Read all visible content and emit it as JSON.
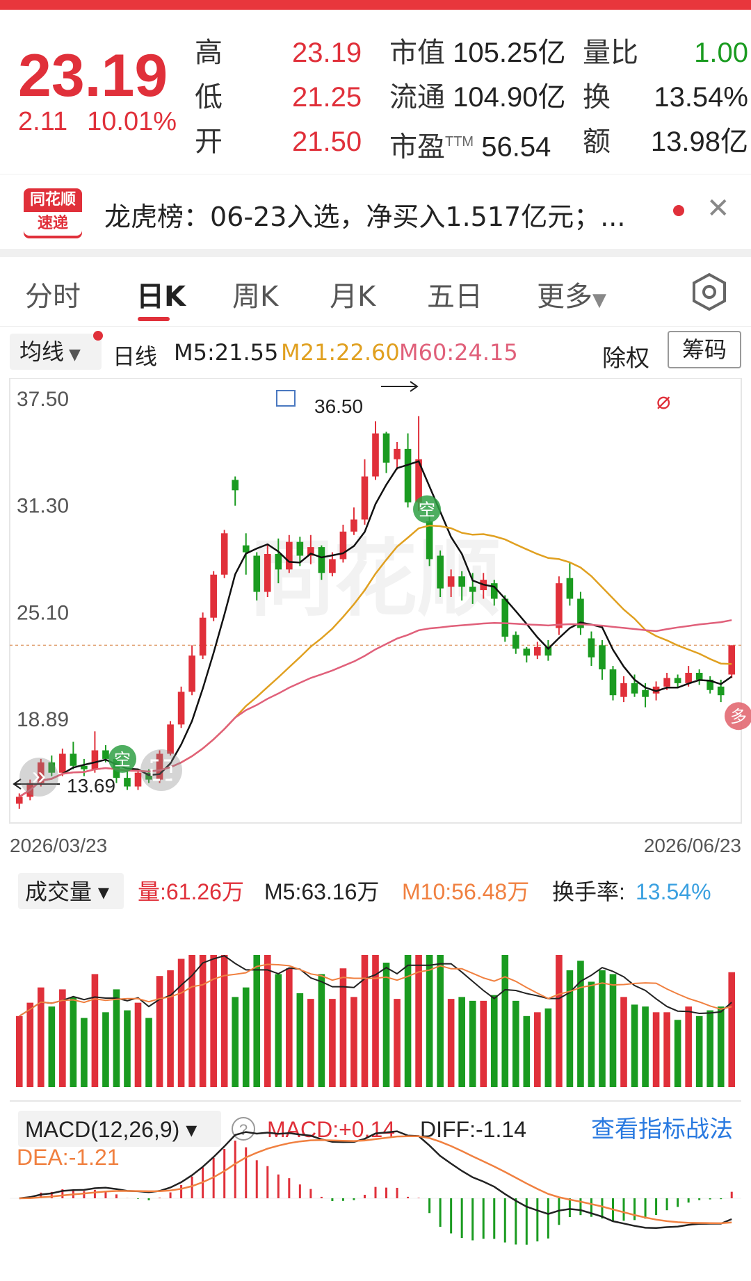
{
  "quote": {
    "price": "23.19",
    "change": "2.11",
    "change_pct": "10.01%",
    "high_label": "高",
    "high": "23.19",
    "low_label": "低",
    "low": "21.25",
    "open_label": "开",
    "open": "21.50",
    "mktcap_label": "市值",
    "mktcap": "105.25亿",
    "float_label": "流通",
    "float": "104.90亿",
    "pe_label": "市盈",
    "pe_sup": "TTM",
    "pe": "56.54",
    "volratio_label": "量比",
    "volratio": "1.00",
    "turnover_label": "换",
    "turnover": "13.54%",
    "amount_label": "额",
    "amount": "13.98亿"
  },
  "news": {
    "logo_top": "同花顺",
    "logo_bottom": "速递",
    "text": "龙虎榜：06-23入选，净买入1.517亿元；..."
  },
  "tabs": [
    "分时",
    "日K",
    "周K",
    "月K",
    "五日",
    "更多"
  ],
  "active_tab": "日K",
  "indicator_bar": {
    "ma_select": "均线",
    "period": "日线",
    "m5": "M5:21.55",
    "m21": "M21:22.60",
    "m60": "M60:24.15",
    "adjust": "除权",
    "chips": "筹码"
  },
  "colors": {
    "up": "#e0303a",
    "down": "#1a9b20",
    "m5": "#111111",
    "m21": "#e0a020",
    "m60": "#e0607a",
    "vol_m10": "#f08040",
    "turnover": "#3aa0e0",
    "link": "#2a7ae0"
  },
  "kline": {
    "y_ticks": [
      "37.50",
      "31.30",
      "25.10",
      "18.89"
    ],
    "x_start": "2026/03/23",
    "x_end": "2026/06/23",
    "max_label": "36.50",
    "min_label": "13.69",
    "badge_empty": "空",
    "badge_many": "多",
    "watermark": "同花顺"
  },
  "volume": {
    "select": "成交量",
    "vol": "量:61.26万",
    "m5": "M5:63.16万",
    "m10": "M10:56.48万",
    "turnover_label": "换手率:",
    "turnover": "13.54%"
  },
  "macd": {
    "select": "MACD(12,26,9)",
    "macd": "MACD:+0.14",
    "diff": "DIFF:-1.14",
    "dea": "DEA:-1.21",
    "link": "查看指标战法"
  },
  "chart_data": {
    "type": "candlestick",
    "title": "",
    "x_range": [
      "2026/03/23",
      "2026/06/23"
    ],
    "ylim": [
      13.69,
      37.5
    ],
    "candles": [
      [
        14.0,
        14.4,
        13.7,
        14.6
      ],
      [
        14.4,
        15.2,
        14.2,
        15.4
      ],
      [
        15.2,
        16.4,
        15.0,
        16.6
      ],
      [
        16.4,
        15.8,
        15.6,
        16.8
      ],
      [
        15.8,
        16.9,
        15.6,
        17.2
      ],
      [
        16.9,
        16.2,
        16.0,
        17.6
      ],
      [
        16.2,
        16.0,
        15.6,
        16.6
      ],
      [
        16.0,
        17.1,
        15.8,
        18.2
      ],
      [
        17.1,
        16.6,
        16.4,
        17.4
      ],
      [
        16.6,
        15.5,
        15.2,
        16.8
      ],
      [
        15.5,
        15.0,
        14.8,
        15.9
      ],
      [
        15.0,
        15.8,
        14.8,
        16.0
      ],
      [
        15.8,
        15.4,
        15.2,
        16.0
      ],
      [
        15.4,
        16.9,
        15.2,
        17.1
      ],
      [
        16.9,
        18.6,
        16.8,
        18.8
      ],
      [
        18.6,
        20.5,
        18.4,
        20.8
      ],
      [
        20.5,
        22.6,
        20.3,
        23.2
      ],
      [
        22.6,
        24.8,
        22.4,
        25.1
      ],
      [
        24.8,
        27.3,
        24.6,
        27.5
      ],
      [
        27.3,
        29.7,
        27.1,
        29.9
      ],
      [
        32.8,
        32.2,
        31.3,
        33.0
      ],
      [
        29.0,
        28.6,
        27.3,
        29.7
      ],
      [
        28.4,
        26.3,
        25.8,
        28.6
      ],
      [
        26.3,
        28.5,
        26.0,
        29.1
      ],
      [
        28.5,
        27.6,
        26.8,
        29.4
      ],
      [
        27.6,
        29.2,
        27.4,
        29.6
      ],
      [
        29.2,
        28.4,
        27.8,
        29.5
      ],
      [
        28.4,
        28.9,
        27.9,
        29.6
      ],
      [
        28.9,
        27.4,
        27.0,
        29.0
      ],
      [
        27.4,
        28.2,
        27.2,
        28.6
      ],
      [
        28.2,
        29.8,
        28.0,
        30.2
      ],
      [
        29.8,
        30.5,
        29.6,
        31.2
      ],
      [
        30.5,
        33.0,
        30.2,
        34.0
      ],
      [
        33.0,
        35.5,
        32.8,
        36.2
      ],
      [
        35.5,
        33.8,
        33.2,
        35.6
      ],
      [
        34.0,
        34.6,
        33.4,
        35.0
      ],
      [
        34.6,
        31.5,
        31.2,
        35.5
      ],
      [
        31.5,
        34.0,
        31.0,
        36.5
      ],
      [
        30.4,
        28.2,
        27.8,
        30.8
      ],
      [
        28.4,
        26.5,
        26.0,
        28.7
      ],
      [
        26.6,
        27.2,
        26.0,
        27.6
      ],
      [
        27.2,
        26.6,
        25.8,
        27.5
      ],
      [
        26.6,
        26.3,
        25.6,
        27.4
      ],
      [
        26.4,
        27.0,
        25.9,
        27.4
      ],
      [
        26.8,
        25.9,
        25.5,
        27.0
      ],
      [
        25.9,
        23.7,
        23.4,
        26.1
      ],
      [
        23.8,
        23.0,
        22.7,
        24.0
      ],
      [
        23.0,
        22.6,
        22.2,
        23.1
      ],
      [
        22.6,
        23.1,
        22.4,
        23.4
      ],
      [
        23.1,
        22.6,
        22.3,
        23.5
      ],
      [
        24.2,
        26.8,
        23.8,
        27.2
      ],
      [
        27.1,
        25.9,
        25.5,
        28.0
      ],
      [
        25.9,
        24.2,
        23.8,
        26.3
      ],
      [
        23.6,
        22.5,
        22.0,
        24.0
      ],
      [
        23.2,
        21.8,
        21.2,
        23.5
      ],
      [
        21.8,
        20.3,
        20.0,
        22.0
      ],
      [
        20.2,
        21.0,
        19.9,
        21.4
      ],
      [
        21.0,
        20.4,
        20.2,
        21.5
      ],
      [
        20.6,
        20.2,
        19.6,
        21.0
      ],
      [
        20.4,
        20.8,
        20.0,
        21.1
      ],
      [
        20.8,
        21.3,
        20.6,
        21.6
      ],
      [
        21.3,
        21.0,
        20.7,
        21.5
      ],
      [
        21.0,
        21.6,
        20.8,
        22.0
      ],
      [
        21.6,
        21.2,
        20.9,
        21.8
      ],
      [
        21.2,
        20.6,
        20.4,
        21.4
      ],
      [
        20.8,
        20.3,
        19.9,
        21.2
      ],
      [
        21.5,
        23.2,
        21.3,
        23.2
      ]
    ],
    "ma5_label": "M5:21.55",
    "ma21_label": "M21:22.60",
    "ma60_label": "M60:24.15"
  }
}
